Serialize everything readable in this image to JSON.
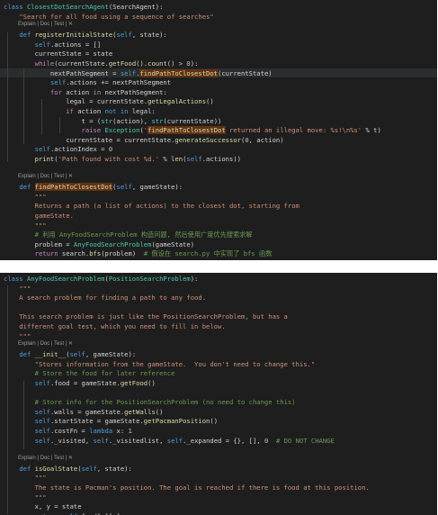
{
  "panel1": {
    "lines": [
      {
        "tokens": [
          {
            "t": "class ",
            "c": "kw"
          },
          {
            "t": "ClosestDotSearchAgent",
            "c": "cls"
          },
          {
            "t": "(SearchAgent):"
          }
        ]
      },
      {
        "tokens": [
          {
            "t": "    "
          },
          {
            "t": "\"Search for all food using a sequence of searches\"",
            "c": "str"
          }
        ]
      },
      {
        "lens": "Explain | Doc | Test | ✕"
      },
      {
        "tokens": [
          {
            "t": "    "
          },
          {
            "t": "def ",
            "c": "kw"
          },
          {
            "t": "registerInitialState",
            "c": "fn"
          },
          {
            "t": "("
          },
          {
            "t": "self",
            "c": "self"
          },
          {
            "t": ", state):"
          }
        ]
      },
      {
        "tokens": [
          {
            "t": "        "
          },
          {
            "t": "self",
            "c": "self"
          },
          {
            "t": ".actions = []"
          }
        ]
      },
      {
        "tokens": [
          {
            "t": "        currentState = state"
          }
        ]
      },
      {
        "tokens": [
          {
            "t": "        "
          },
          {
            "t": "while",
            "c": "ctl"
          },
          {
            "t": "(currentState."
          },
          {
            "t": "getFood",
            "c": "fn"
          },
          {
            "t": "()."
          },
          {
            "t": "count",
            "c": "fn"
          },
          {
            "t": "() > "
          },
          {
            "t": "0",
            "c": "num"
          },
          {
            "t": "):"
          }
        ]
      },
      {
        "tokens": [
          {
            "t": "            nextPathSegment = "
          },
          {
            "t": "self",
            "c": "self"
          },
          {
            "t": "."
          },
          {
            "t": "findPathToClosestDot",
            "c": "mark"
          },
          {
            "t": "(currentState)"
          }
        ],
        "highlight": true
      },
      {
        "tokens": [
          {
            "t": "            "
          },
          {
            "t": "self",
            "c": "self"
          },
          {
            "t": ".actions += nextPathSegment"
          }
        ]
      },
      {
        "tokens": [
          {
            "t": "            "
          },
          {
            "t": "for",
            "c": "ctl"
          },
          {
            "t": " action "
          },
          {
            "t": "in",
            "c": "ctl"
          },
          {
            "t": " nextPathSegment:"
          }
        ]
      },
      {
        "tokens": [
          {
            "t": "                legal = currentState."
          },
          {
            "t": "getLegalActions",
            "c": "fn"
          },
          {
            "t": "()"
          }
        ]
      },
      {
        "tokens": [
          {
            "t": "                "
          },
          {
            "t": "if",
            "c": "ctl"
          },
          {
            "t": " action "
          },
          {
            "t": "not in",
            "c": "kw"
          },
          {
            "t": " legal:"
          }
        ]
      },
      {
        "tokens": [
          {
            "t": "                    t = ("
          },
          {
            "t": "str",
            "c": "cls"
          },
          {
            "t": "(action), "
          },
          {
            "t": "str",
            "c": "cls"
          },
          {
            "t": "(currentState))"
          }
        ]
      },
      {
        "tokens": [
          {
            "t": "                    "
          },
          {
            "t": "raise",
            "c": "ctl"
          },
          {
            "t": " "
          },
          {
            "t": "Exception",
            "c": "cls"
          },
          {
            "t": "("
          },
          {
            "t": "'",
            "c": "str"
          },
          {
            "t": "findPathToClosestDot",
            "c": "mark"
          },
          {
            "t": " returned an illegal move: %s!\\n%s'",
            "c": "str"
          },
          {
            "t": " % t)"
          }
        ]
      },
      {
        "tokens": [
          {
            "t": "                currentState = currentState."
          },
          {
            "t": "generateSuccessor",
            "c": "fn"
          },
          {
            "t": "("
          },
          {
            "t": "0",
            "c": "num"
          },
          {
            "t": ", action)"
          }
        ]
      },
      {
        "tokens": [
          {
            "t": "        "
          },
          {
            "t": "self",
            "c": "self"
          },
          {
            "t": ".actionIndex = "
          },
          {
            "t": "0",
            "c": "num"
          }
        ]
      },
      {
        "tokens": [
          {
            "t": "        "
          },
          {
            "t": "print",
            "c": "fn"
          },
          {
            "t": "("
          },
          {
            "t": "'Path found with cost %d.'",
            "c": "str"
          },
          {
            "t": " % "
          },
          {
            "t": "len",
            "c": "fn"
          },
          {
            "t": "("
          },
          {
            "t": "self",
            "c": "self"
          },
          {
            "t": ".actions))"
          }
        ]
      },
      {
        "blank": true
      },
      {
        "lens": "Explain | Doc | Test | ✕"
      },
      {
        "tokens": [
          {
            "t": "    "
          },
          {
            "t": "def ",
            "c": "kw"
          },
          {
            "t": "findPathToClosestDot",
            "c": "mark"
          },
          {
            "t": "("
          },
          {
            "t": "self",
            "c": "self"
          },
          {
            "t": ", gameState):"
          }
        ]
      },
      {
        "tokens": [
          {
            "t": "        "
          },
          {
            "t": "\"\"\"",
            "c": "str"
          }
        ]
      },
      {
        "tokens": [
          {
            "t": "        Returns a path (a list of actions) to the closest dot, starting from",
            "c": "str"
          }
        ]
      },
      {
        "tokens": [
          {
            "t": "        gameState.",
            "c": "str"
          }
        ]
      },
      {
        "tokens": [
          {
            "t": "        "
          },
          {
            "t": "\"\"\"",
            "c": "str"
          }
        ]
      },
      {
        "tokens": [
          {
            "t": "        "
          },
          {
            "t": "# 利用 AnyFoodSearchProblem 构造问题, 然后使用广度优先搜索求解",
            "c": "cm"
          }
        ]
      },
      {
        "tokens": [
          {
            "t": "        problem = "
          },
          {
            "t": "AnyFoodSearchProblem",
            "c": "cls"
          },
          {
            "t": "(gameState)"
          }
        ]
      },
      {
        "tokens": [
          {
            "t": "        "
          },
          {
            "t": "return",
            "c": "ctl"
          },
          {
            "t": " search."
          },
          {
            "t": "bfs",
            "c": "fn"
          },
          {
            "t": "(problem)  "
          },
          {
            "t": "# 假设在 search.py 中实现了 bfs 函数",
            "c": "cm"
          }
        ]
      }
    ]
  },
  "panel2": {
    "lines": [
      {
        "tokens": [
          {
            "t": "class ",
            "c": "kw"
          },
          {
            "t": "AnyFoodSearchProblem",
            "c": "cls"
          },
          {
            "t": "("
          },
          {
            "t": "PositionSearchProblem",
            "c": "cls"
          },
          {
            "t": "):"
          }
        ]
      },
      {
        "tokens": [
          {
            "t": "    "
          },
          {
            "t": "\"\"\"",
            "c": "str"
          }
        ]
      },
      {
        "tokens": [
          {
            "t": "    A search problem for finding a path to any food.",
            "c": "str"
          }
        ]
      },
      {
        "blank": true
      },
      {
        "tokens": [
          {
            "t": "    This search problem is just like the PositionSearchProblem, but has a",
            "c": "str"
          }
        ]
      },
      {
        "tokens": [
          {
            "t": "    different goal test, which you need to fill in below.",
            "c": "str"
          }
        ]
      },
      {
        "tokens": [
          {
            "t": "    \"\"\"",
            "c": "str"
          }
        ]
      },
      {
        "lens": "Explain | Doc | Test | ✕"
      },
      {
        "tokens": [
          {
            "t": "    "
          },
          {
            "t": "def ",
            "c": "kw"
          },
          {
            "t": "__init__",
            "c": "fn"
          },
          {
            "t": "("
          },
          {
            "t": "self",
            "c": "self"
          },
          {
            "t": ", gameState):"
          }
        ]
      },
      {
        "tokens": [
          {
            "t": "        "
          },
          {
            "t": "\"Stores information from the gameState.  You don't need to change this.\"",
            "c": "str"
          }
        ]
      },
      {
        "tokens": [
          {
            "t": "        "
          },
          {
            "t": "# Store the food for later reference",
            "c": "cm"
          }
        ]
      },
      {
        "tokens": [
          {
            "t": "        "
          },
          {
            "t": "self",
            "c": "self"
          },
          {
            "t": ".food = gameState."
          },
          {
            "t": "getFood",
            "c": "fn"
          },
          {
            "t": "()"
          }
        ]
      },
      {
        "blank": true
      },
      {
        "tokens": [
          {
            "t": "        "
          },
          {
            "t": "# Store info for the PositionSearchProblem (no need to change this)",
            "c": "cm"
          }
        ]
      },
      {
        "tokens": [
          {
            "t": "        "
          },
          {
            "t": "self",
            "c": "self"
          },
          {
            "t": ".walls = gameState."
          },
          {
            "t": "getWalls",
            "c": "fn"
          },
          {
            "t": "()"
          }
        ]
      },
      {
        "tokens": [
          {
            "t": "        "
          },
          {
            "t": "self",
            "c": "self"
          },
          {
            "t": ".startState = gameState."
          },
          {
            "t": "getPacmanPosition",
            "c": "fn"
          },
          {
            "t": "()"
          }
        ]
      },
      {
        "tokens": [
          {
            "t": "        "
          },
          {
            "t": "self",
            "c": "self"
          },
          {
            "t": ".costFn = "
          },
          {
            "t": "lambda",
            "c": "kw"
          },
          {
            "t": " x: "
          },
          {
            "t": "1",
            "c": "num"
          }
        ]
      },
      {
        "tokens": [
          {
            "t": "        "
          },
          {
            "t": "self",
            "c": "self"
          },
          {
            "t": "._visited, "
          },
          {
            "t": "self",
            "c": "self"
          },
          {
            "t": "._visitedlist, "
          },
          {
            "t": "self",
            "c": "self"
          },
          {
            "t": "._expanded = {}, [], "
          },
          {
            "t": "0",
            "c": "num"
          },
          {
            "t": "  "
          },
          {
            "t": "# DO NOT CHANGE",
            "c": "cm"
          }
        ]
      },
      {
        "blank": true
      },
      {
        "lens": "Explain | Doc | Test | ✕"
      },
      {
        "tokens": [
          {
            "t": "    "
          },
          {
            "t": "def ",
            "c": "kw"
          },
          {
            "t": "isGoalState",
            "c": "fn"
          },
          {
            "t": "("
          },
          {
            "t": "self",
            "c": "self"
          },
          {
            "t": ", state):"
          }
        ]
      },
      {
        "tokens": [
          {
            "t": "        "
          },
          {
            "t": "\"\"\"",
            "c": "str"
          }
        ]
      },
      {
        "tokens": [
          {
            "t": "        The state is Pacman's position. The goal is reached if there is food at this position.",
            "c": "str"
          }
        ]
      },
      {
        "tokens": [
          {
            "t": "        "
          },
          {
            "t": "\"\"\"",
            "c": "str"
          }
        ]
      },
      {
        "tokens": [
          {
            "t": "        x, y = state"
          }
        ]
      },
      {
        "tokens": [
          {
            "t": "        "
          },
          {
            "t": "return",
            "c": "ctl"
          },
          {
            "t": " "
          },
          {
            "t": "self",
            "c": "self"
          },
          {
            "t": ".food[x][y]"
          }
        ]
      }
    ]
  }
}
